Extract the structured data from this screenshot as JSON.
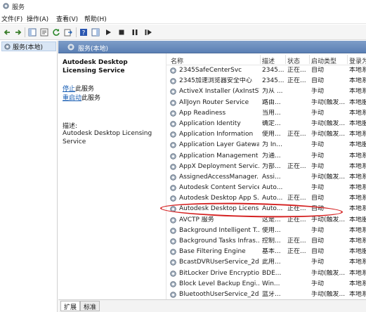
{
  "window": {
    "title": "服务"
  },
  "menu": [
    "文件(F)",
    "操作(A)",
    "查看(V)",
    "帮助(H)"
  ],
  "toolbar": {
    "icons": [
      "back-arrow-icon",
      "forward-arrow-icon",
      "show-tree-icon",
      "properties-icon",
      "refresh-icon",
      "export-icon",
      "help-icon",
      "panel-icon",
      "play-icon",
      "stop-icon",
      "pause-icon",
      "restart-icon"
    ]
  },
  "tree": {
    "selected": "服务(本地)"
  },
  "header": {
    "title": "服务(本地)"
  },
  "details": {
    "service_name": "Autodesk Desktop Licensing Service",
    "stop_link": "停止",
    "stop_suffix": "此服务",
    "restart_link": "重启动",
    "restart_suffix": "此服务",
    "desc_label": "描述:",
    "desc_text": "Autodesk Desktop Licensing Service"
  },
  "columns": {
    "name": "名称",
    "desc": "描述",
    "status": "状态",
    "startup": "启动类型",
    "logon": "登录为"
  },
  "services": [
    {
      "name": "2345SafeCenterSvc",
      "desc": "2345...",
      "status": "正在...",
      "startup": "自动",
      "logon": "本地系"
    },
    {
      "name": "2345加速浏览器安全中心",
      "desc": "2345...",
      "status": "正在...",
      "startup": "自动",
      "logon": "本地系"
    },
    {
      "name": "ActiveX Installer (AxInstSV)",
      "desc": "为从 ...",
      "status": "",
      "startup": "手动",
      "logon": "本地系"
    },
    {
      "name": "AllJoyn Router Service",
      "desc": "路由...",
      "status": "",
      "startup": "手动(触发...",
      "logon": "本地服"
    },
    {
      "name": "App Readiness",
      "desc": "当用...",
      "status": "",
      "startup": "手动",
      "logon": "本地系"
    },
    {
      "name": "Application Identity",
      "desc": "确定...",
      "status": "",
      "startup": "手动(触发...",
      "logon": "本地服"
    },
    {
      "name": "Application Information",
      "desc": "使用...",
      "status": "正在...",
      "startup": "手动(触发...",
      "logon": "本地系"
    },
    {
      "name": "Application Layer Gatewa...",
      "desc": "为 In...",
      "status": "",
      "startup": "手动",
      "logon": "本地服"
    },
    {
      "name": "Application Management",
      "desc": "为通...",
      "status": "",
      "startup": "手动",
      "logon": "本地系"
    },
    {
      "name": "AppX Deployment Servic...",
      "desc": "为部...",
      "status": "正在...",
      "startup": "手动",
      "logon": "本地系"
    },
    {
      "name": "AssignedAccessManager...",
      "desc": "Assi...",
      "status": "",
      "startup": "手动(触发...",
      "logon": "本地系"
    },
    {
      "name": "Autodesk Content Service",
      "desc": "Auto...",
      "status": "",
      "startup": "手动",
      "logon": "本地系"
    },
    {
      "name": "Autodesk Desktop App S...",
      "desc": "Auto...",
      "status": "正在...",
      "startup": "自动",
      "logon": "本地系"
    },
    {
      "name": "Autodesk Desktop Licens...",
      "desc": "Auto...",
      "status": "正在...",
      "startup": "自动",
      "logon": "本地系"
    },
    {
      "name": "AVCTP 服务",
      "desc": "这是...",
      "status": "正在...",
      "startup": "手动(触发...",
      "logon": "本地服"
    },
    {
      "name": "Background Intelligent T...",
      "desc": "使用...",
      "status": "",
      "startup": "手动",
      "logon": "本地系"
    },
    {
      "name": "Background Tasks Infras...",
      "desc": "控制...",
      "status": "正在...",
      "startup": "自动",
      "logon": "本地系"
    },
    {
      "name": "Base Filtering Engine",
      "desc": "基本...",
      "status": "正在...",
      "startup": "自动",
      "logon": "本地服"
    },
    {
      "name": "BcastDVRUserService_2d...",
      "desc": "此用...",
      "status": "",
      "startup": "手动",
      "logon": "本地系"
    },
    {
      "name": "BitLocker Drive Encryptio...",
      "desc": "BDE...",
      "status": "",
      "startup": "手动(触发...",
      "logon": "本地系"
    },
    {
      "name": "Block Level Backup Engi...",
      "desc": "Win...",
      "status": "",
      "startup": "手动",
      "logon": "本地系"
    },
    {
      "name": "BluetoothUserService_2d...",
      "desc": "蓝牙...",
      "status": "",
      "startup": "手动(触发...",
      "logon": "本地系"
    }
  ],
  "tabs": [
    "扩展",
    "标准"
  ],
  "colors": {
    "header": "#5a7fb4",
    "highlight": "#d42020",
    "link": "#1a5fb4"
  }
}
